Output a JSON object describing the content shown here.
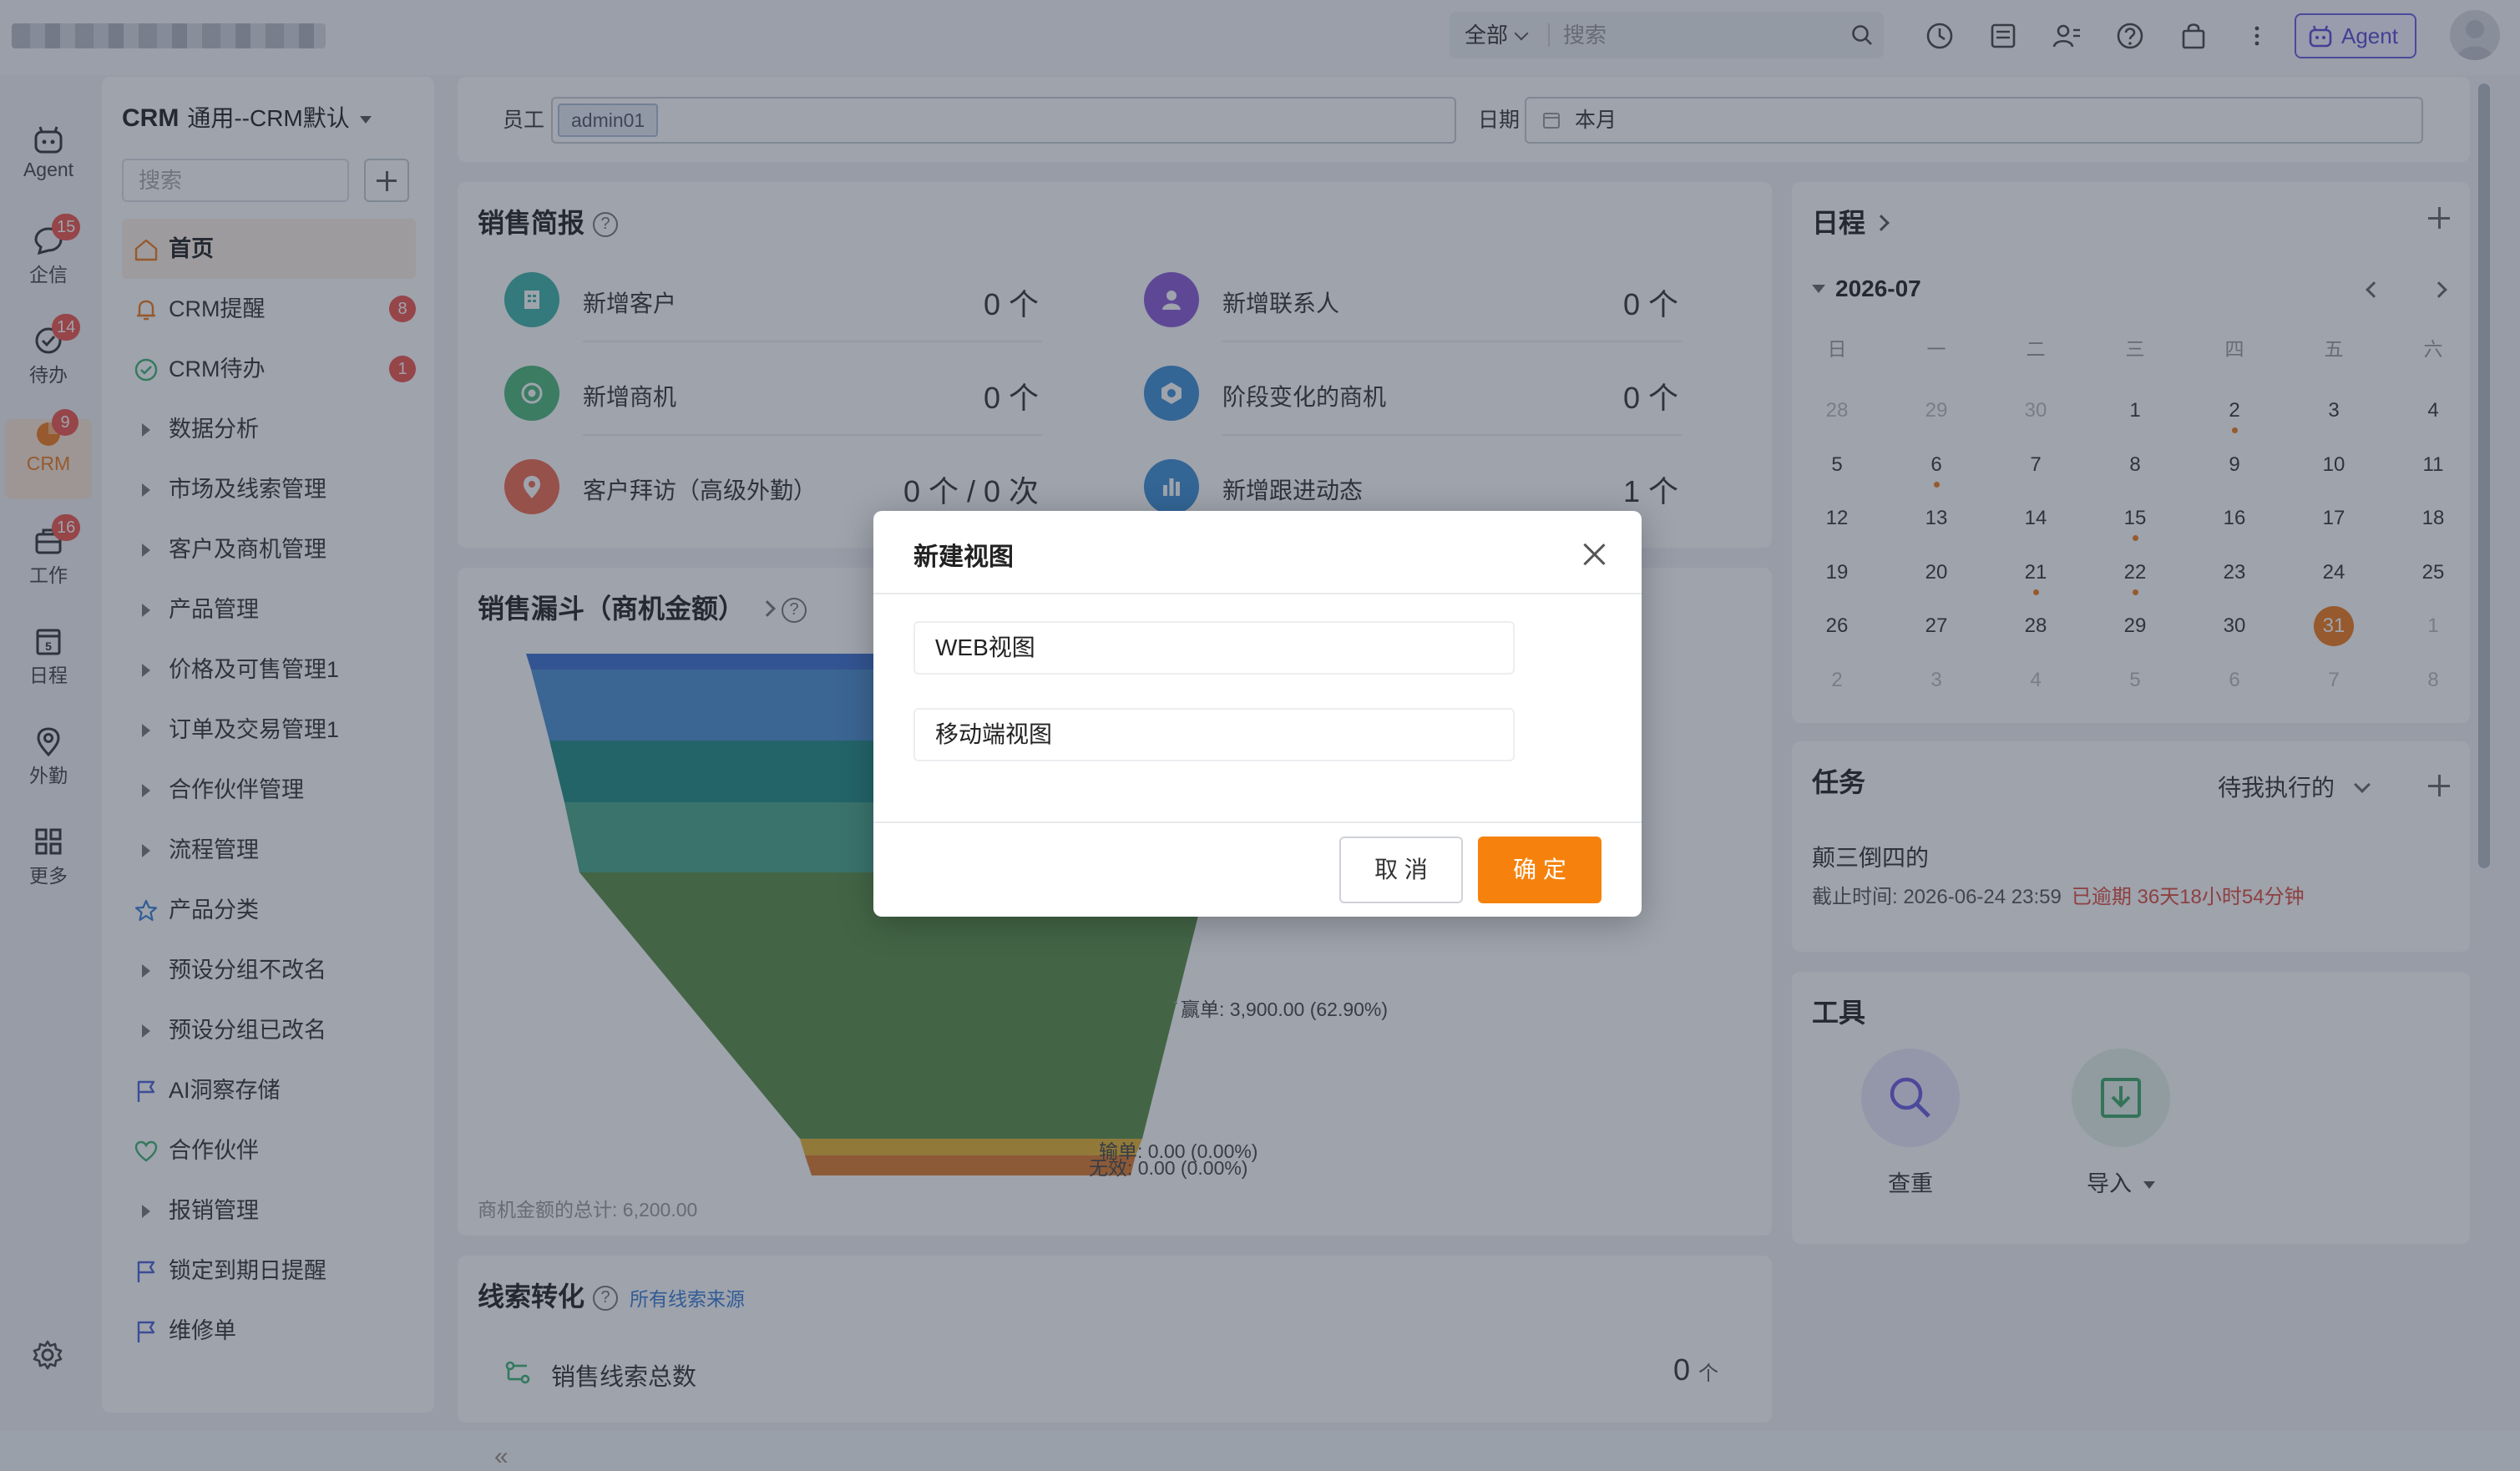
{
  "topbar": {
    "scope": "全部",
    "search_placeholder": "搜索",
    "agent_label": "Agent"
  },
  "rail": {
    "items": [
      {
        "label": "Agent",
        "badge": ""
      },
      {
        "label": "企信",
        "badge": "15"
      },
      {
        "label": "待办",
        "badge": "14"
      },
      {
        "label": "CRM",
        "badge": "9"
      },
      {
        "label": "工作",
        "badge": "16"
      },
      {
        "label": "日程",
        "badge": ""
      },
      {
        "label": "外勤",
        "badge": ""
      },
      {
        "label": "更多",
        "badge": ""
      }
    ]
  },
  "sidebar": {
    "app_name": "CRM",
    "view_name": "通用--CRM默认",
    "search_placeholder": "搜索",
    "items": [
      {
        "label": "首页",
        "badge": ""
      },
      {
        "label": "CRM提醒",
        "badge": "8"
      },
      {
        "label": "CRM待办",
        "badge": "1"
      },
      {
        "label": "数据分析",
        "badge": ""
      },
      {
        "label": "市场及线索管理",
        "badge": ""
      },
      {
        "label": "客户及商机管理",
        "badge": ""
      },
      {
        "label": "产品管理",
        "badge": ""
      },
      {
        "label": "价格及可售管理1",
        "badge": ""
      },
      {
        "label": "订单及交易管理1",
        "badge": ""
      },
      {
        "label": "合作伙伴管理",
        "badge": ""
      },
      {
        "label": "流程管理",
        "badge": ""
      },
      {
        "label": "产品分类",
        "badge": ""
      },
      {
        "label": "预设分组不改名",
        "badge": ""
      },
      {
        "label": "预设分组已改名",
        "badge": ""
      },
      {
        "label": "AI洞察存储",
        "badge": ""
      },
      {
        "label": "合作伙伴",
        "badge": ""
      },
      {
        "label": "报销管理",
        "badge": ""
      },
      {
        "label": "锁定到期日提醒",
        "badge": ""
      },
      {
        "label": "维修单",
        "badge": ""
      }
    ]
  },
  "filter": {
    "employee_label": "员工",
    "employee_tag": "admin01",
    "date_label": "日期",
    "date_value": "本月"
  },
  "sales": {
    "title": "销售简报",
    "stats": [
      {
        "label": "新增客户",
        "value": "0 个",
        "color": "#3fb3a6"
      },
      {
        "label": "新增联系人",
        "value": "0 个",
        "color": "#8b5ad8"
      },
      {
        "label": "新增商机",
        "value": "0 个",
        "color": "#4cb87a"
      },
      {
        "label": "阶段变化的商机",
        "value": "0 个",
        "color": "#3d8fd6"
      },
      {
        "label": "客户拜访（高级外勤）",
        "value": "0 个 / 0 次",
        "color": "#ef6a4d"
      },
      {
        "label": "新增跟进动态",
        "value": "1 个",
        "color": "#3d8fd6"
      }
    ]
  },
  "funnel": {
    "title": "销售漏斗（商机金额）",
    "labels": {
      "win": "赢单: 3,900.00 (62.90%)",
      "lose": "输单: 0.00 (0.00%)",
      "invalid": "无效: 0.00 (0.00%)"
    },
    "total": "商机金额的总计: 6,200.00"
  },
  "lead": {
    "title": "线索转化",
    "source_link": "所有线索来源",
    "row_label": "销售线索总数",
    "row_value": "0",
    "row_unit": "个"
  },
  "schedule": {
    "title": "日程",
    "month": "2026-07",
    "weekdays": [
      "日",
      "一",
      "二",
      "三",
      "四",
      "五",
      "六"
    ],
    "days": [
      "28",
      "29",
      "30",
      "1",
      "2",
      "3",
      "4",
      "5",
      "6",
      "7",
      "8",
      "9",
      "10",
      "11",
      "12",
      "13",
      "14",
      "15",
      "16",
      "17",
      "18",
      "19",
      "20",
      "21",
      "22",
      "23",
      "24",
      "25",
      "26",
      "27",
      "28",
      "29",
      "30",
      "31",
      "1",
      "2",
      "3",
      "4",
      "5",
      "6",
      "7",
      "8"
    ]
  },
  "task": {
    "title": "任务",
    "filter": "待我执行的",
    "name": "颠三倒四的",
    "deadline": "截止时间: 2026-06-24 23:59",
    "overdue": "已逾期 36天18小时54分钟"
  },
  "tools": {
    "title": "工具",
    "items": [
      {
        "label": "查重"
      },
      {
        "label": "导入"
      }
    ]
  },
  "modal": {
    "title": "新建视图",
    "options": [
      "WEB视图",
      "移动端视图"
    ],
    "cancel": "取 消",
    "ok": "确 定"
  },
  "colors": {
    "accent": "#f07a1b",
    "primary_button": "#f6820d",
    "badge": "#f1554c",
    "overdue": "#e24b3b",
    "agent": "#6b5be0"
  }
}
